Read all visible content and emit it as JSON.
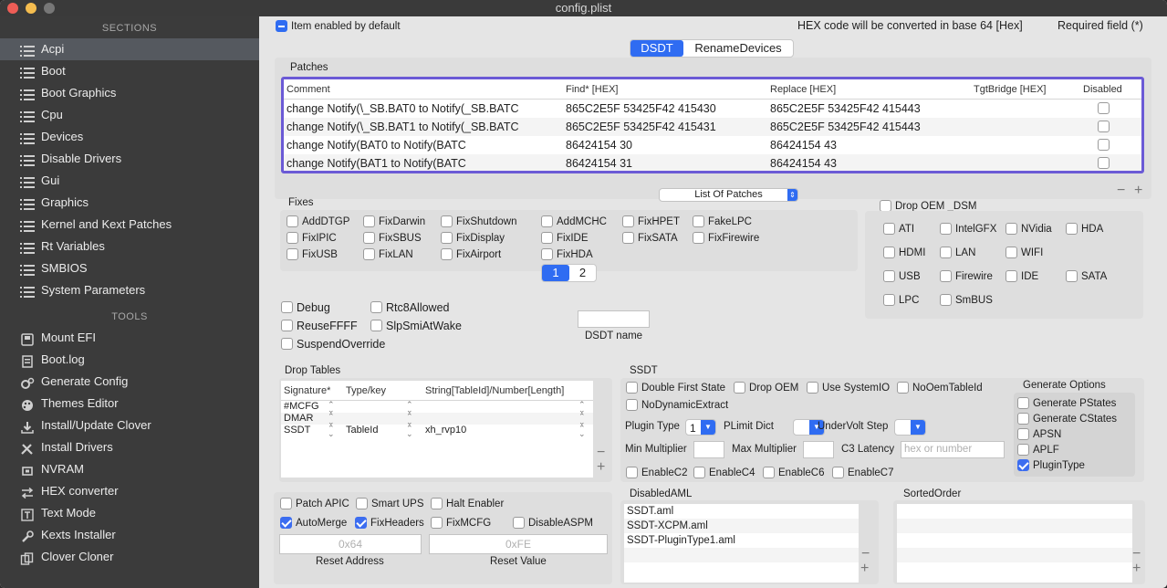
{
  "window": {
    "title": "config.plist"
  },
  "sidebar": {
    "sections_header": "SECTIONS",
    "sections": [
      {
        "label": "Acpi",
        "selected": true
      },
      {
        "label": "Boot"
      },
      {
        "label": "Boot Graphics"
      },
      {
        "label": "Cpu"
      },
      {
        "label": "Devices"
      },
      {
        "label": "Disable Drivers"
      },
      {
        "label": "Gui"
      },
      {
        "label": "Graphics"
      },
      {
        "label": "Kernel and Kext Patches"
      },
      {
        "label": "Rt Variables"
      },
      {
        "label": "SMBIOS"
      },
      {
        "label": "System Parameters"
      }
    ],
    "tools_header": "TOOLS",
    "tools": [
      {
        "label": "Mount EFI",
        "icon": "disk-icon"
      },
      {
        "label": "Boot.log",
        "icon": "log-icon"
      },
      {
        "label": "Generate Config",
        "icon": "gears-icon"
      },
      {
        "label": "Themes Editor",
        "icon": "palette-icon"
      },
      {
        "label": "Install/Update Clover",
        "icon": "download-icon"
      },
      {
        "label": "Install Drivers",
        "icon": "tools-icon"
      },
      {
        "label": "NVRAM",
        "icon": "chip-icon"
      },
      {
        "label": "HEX converter",
        "icon": "arrows-icon"
      },
      {
        "label": "Text Mode",
        "icon": "text-icon"
      },
      {
        "label": "Kexts Installer",
        "icon": "wrench-icon"
      },
      {
        "label": "Clover Cloner",
        "icon": "copy-icon"
      }
    ]
  },
  "top": {
    "item_enabled": "Item enabled by default",
    "hex_note": "HEX code will be converted in base 64 [Hex]",
    "required_note": "Required field (*)"
  },
  "tabs": {
    "dsdt": "DSDT",
    "rename": "RenameDevices"
  },
  "patches": {
    "title": "Patches",
    "headers": [
      "Comment",
      "Find* [HEX]",
      "Replace [HEX]",
      "TgtBridge [HEX]",
      "Disabled"
    ],
    "rows": [
      {
        "comment": "change Notify(\\_SB.BAT0 to Notify(_SB.BATC",
        "find": "865C2E5F 53425F42 415430",
        "replace": "865C2E5F 53425F42 415443",
        "bridge": ""
      },
      {
        "comment": "change Notify(\\_SB.BAT1 to Notify(_SB.BATC",
        "find": "865C2E5F 53425F42 415431",
        "replace": "865C2E5F 53425F42 415443",
        "bridge": ""
      },
      {
        "comment": "change Notify(BAT0 to Notify(BATC",
        "find": "86424154 30",
        "replace": "86424154 43",
        "bridge": ""
      },
      {
        "comment": "change Notify(BAT1 to Notify(BATC",
        "find": "86424154 31",
        "replace": "86424154 43",
        "bridge": ""
      }
    ],
    "list_popup": "List Of Patches"
  },
  "fixes": {
    "title": "Fixes",
    "items": [
      "AddDTGP",
      "FixDarwin",
      "FixShutdown",
      "AddMCHC",
      "FixHPET",
      "FakeLPC",
      "FixIPIC",
      "FixSBUS",
      "FixDisplay",
      "FixIDE",
      "FixSATA",
      "FixFirewire",
      "FixUSB",
      "FixLAN",
      "FixAirport",
      "FixHDA"
    ],
    "page1": "1",
    "page2": "2"
  },
  "drop_oem": {
    "title": "Drop OEM _DSM",
    "items": [
      "ATI",
      "IntelGFX",
      "NVidia",
      "HDA",
      "HDMI",
      "LAN",
      "WIFI",
      "USB",
      "Firewire",
      "IDE",
      "SATA",
      "LPC",
      "SmBUS"
    ]
  },
  "misc": {
    "debug": "Debug",
    "rtc": "Rtc8Allowed",
    "reuse": "ReuseFFFF",
    "slp": "SlpSmiAtWake",
    "suspend": "SuspendOverride",
    "dsdt_name_label": "DSDT name",
    "dsdt_name_value": ""
  },
  "drop_tables": {
    "title": "Drop Tables",
    "headers": [
      "Signature*",
      "Type/key",
      "String[TableId]/Number[Length]"
    ],
    "rows": [
      {
        "sig": "#MCFG",
        "type": "",
        "str": ""
      },
      {
        "sig": "DMAR",
        "type": "",
        "str": ""
      },
      {
        "sig": "SSDT",
        "type": "TableId",
        "str": "xh_rvp10"
      }
    ]
  },
  "ssdt": {
    "title": "SSDT",
    "double_first": "Double First State",
    "drop_oem": "Drop OEM",
    "use_sysio": "Use SystemIO",
    "no_oem_id": "NoOemTableId",
    "no_dyn": "NoDynamicExtract",
    "plugin_type_label": "Plugin Type",
    "plugin_type_value": "1",
    "plimit_label": "PLimit Dict",
    "plimit_value": "",
    "undervolt_label": "UnderVolt Step",
    "undervolt_value": "",
    "min_mult": "Min Multiplier",
    "max_mult": "Max Multiplier",
    "c3_label": "C3 Latency",
    "c3_placeholder": "hex or number",
    "c2": "EnableC2",
    "c4": "EnableC4",
    "c6": "EnableC6",
    "c7": "EnableC7",
    "gen_title": "Generate Options",
    "gen_items": [
      {
        "label": "Generate PStates",
        "checked": false
      },
      {
        "label": "Generate CStates",
        "checked": false
      },
      {
        "label": "APSN",
        "checked": false
      },
      {
        "label": "APLF",
        "checked": false
      },
      {
        "label": "PluginType",
        "checked": true
      }
    ]
  },
  "bottom_left": {
    "patch_apic": "Patch APIC",
    "smart_ups": "Smart UPS",
    "halt": "Halt Enabler",
    "automerge": "AutoMerge",
    "fixheaders": "FixHeaders",
    "fixmcfg": "FixMCFG",
    "disableaspm": "DisableASPM",
    "reset_addr_ph": "0x64",
    "reset_val_ph": "0xFE",
    "reset_addr_label": "Reset Address",
    "reset_val_label": "Reset Value"
  },
  "disabled_aml": {
    "title": "DisabledAML",
    "items": [
      "SSDT.aml",
      "SSDT-XCPM.aml",
      "SSDT-PluginType1.aml"
    ]
  },
  "sorted_order": {
    "title": "SortedOrder"
  }
}
